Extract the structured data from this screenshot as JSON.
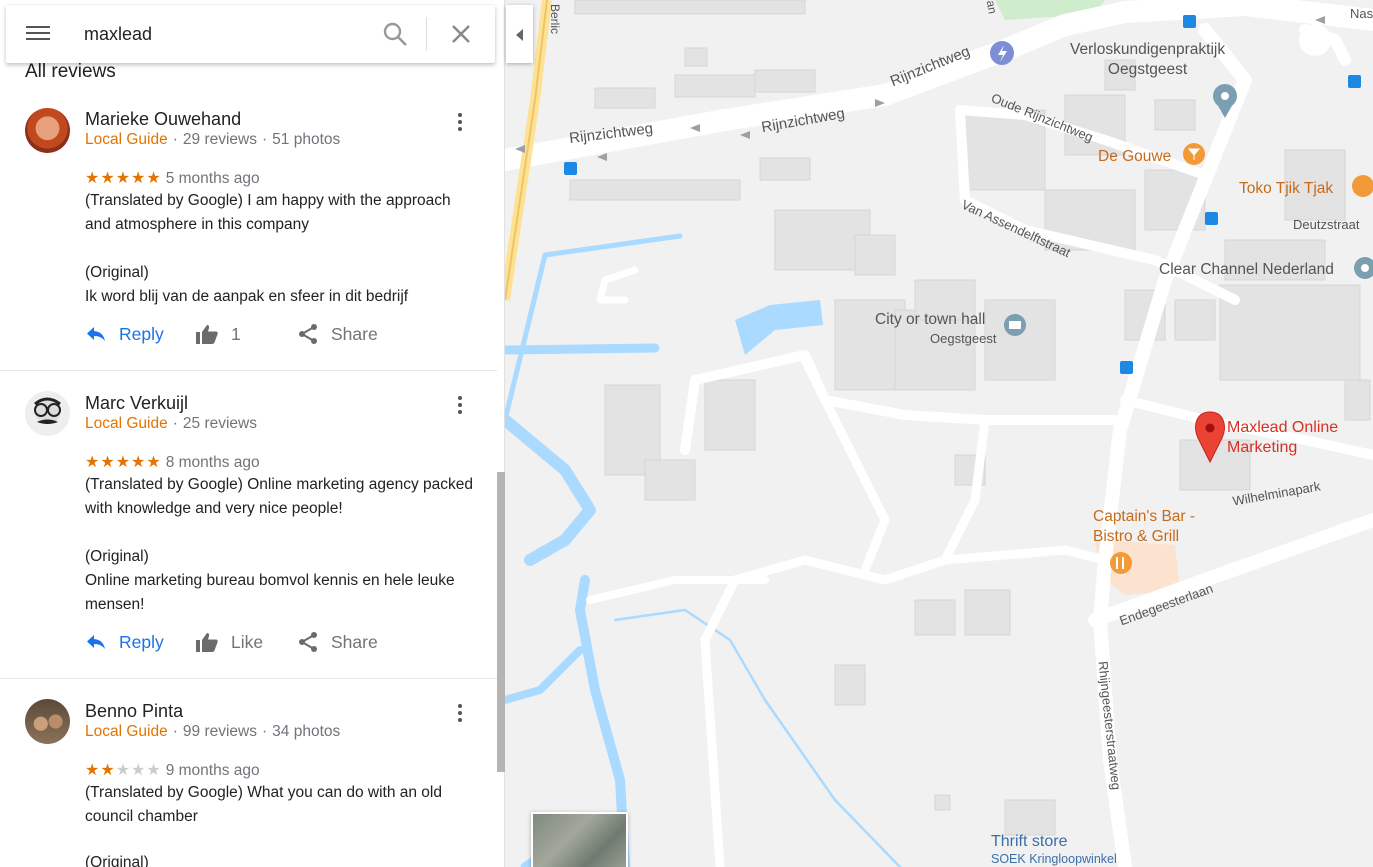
{
  "search": {
    "value": "maxlead"
  },
  "panel": {
    "heading": "All reviews"
  },
  "actions": {
    "reply": "Reply",
    "like": "Like",
    "share": "Share"
  },
  "reviews": [
    {
      "name": "Marieke Ouwehand",
      "badge": "Local Guide",
      "review_count": "29 reviews",
      "photo_count": "51 photos",
      "rating": 5,
      "stars_on": "★★★★★",
      "stars_off": "",
      "time": "5 months ago",
      "translated": "(Translated by Google) I am happy with the approach and atmosphere in this company",
      "original_label": "(Original)",
      "original": "Ik word blij van de aanpak en sfeer in dit bedrijf",
      "likes": "1"
    },
    {
      "name": "Marc Verkuijl",
      "badge": "Local Guide",
      "review_count": "25 reviews",
      "rating": 5,
      "stars_on": "★★★★★",
      "stars_off": "",
      "time": "8 months ago",
      "translated": "(Translated by Google) Online marketing agency packed with knowledge and very nice people!",
      "original_label": "(Original)",
      "original": "Online marketing bureau bomvol kennis en hele leuke mensen!"
    },
    {
      "name": "Benno Pinta",
      "badge": "Local Guide",
      "review_count": "99 reviews",
      "photo_count": "34 photos",
      "rating": 2,
      "stars_on": "★★",
      "stars_off": "★★★",
      "time": "9 months ago",
      "translated": "(Translated by Google) What you can do with an old council chamber",
      "original_label": "(Original)"
    }
  ],
  "map": {
    "places": {
      "verlos": "Verloskundigenpraktijk\nOegstgeest",
      "gouwe": "De Gouwe",
      "toko": "Toko Tjik Tjak",
      "clear": "Clear Channel Nederland",
      "cityhall": "City or town hall",
      "cityhall_sub": "Oegstgeest",
      "maxlead": "Maxlead Online\nMarketing",
      "captains": "Captain's Bar -\nBistro & Grill",
      "thrift": "Thrift store",
      "thrift_sub": "SOEK Kringloopwinkel"
    },
    "streets": {
      "rijn1": "Rijnzichtweg",
      "rijn2": "Rijnzichtweg",
      "rijn3": "Rijnzichtweg",
      "oude_rijn": "Oude Rijnzichtweg",
      "assendelft": "Van Assendelftstraat",
      "deutz": "Deutzstraat",
      "wilhelmina": "Wilhelminapark",
      "endegeest": "Endegeesterlaan",
      "rhijngeest": "Rhijngeesterstraatweg",
      "berlic": "Berlic",
      "nas": "Nas",
      "an": "an"
    },
    "colors": {
      "water": "#aadaff",
      "road": "#ffffff",
      "building": "#e4e4e4",
      "marker": "#ea4335",
      "food": "#f29a38",
      "civic": "#7b9eb0",
      "poi_dark": "#555555"
    }
  }
}
